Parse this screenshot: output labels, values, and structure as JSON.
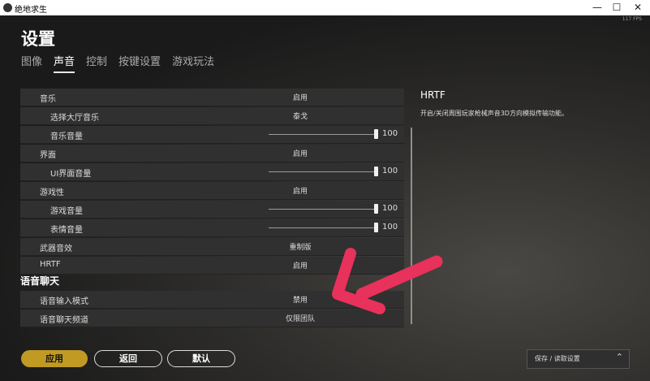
{
  "window": {
    "title": "绝地求生",
    "minimize": "—",
    "maximize": "☐",
    "close": "✕"
  },
  "fps": "117 FPS",
  "page": {
    "title": "设置"
  },
  "tabs": [
    {
      "label": "图像",
      "active": false
    },
    {
      "label": "声音",
      "active": true
    },
    {
      "label": "控制",
      "active": false
    },
    {
      "label": "按键设置",
      "active": false
    },
    {
      "label": "游戏玩法",
      "active": false
    }
  ],
  "settings": [
    {
      "label": "音乐",
      "value": "启用"
    },
    {
      "label": "选择大厅音乐",
      "value": "泰戈"
    },
    {
      "label": "音乐音量",
      "slider_value": "100"
    },
    {
      "label": "界面",
      "value": "启用"
    },
    {
      "label": "UI界面音量",
      "slider_value": "100"
    },
    {
      "label": "游戏性",
      "value": "启用"
    },
    {
      "label": "游戏音量",
      "slider_value": "100"
    },
    {
      "label": "表情音量",
      "slider_value": "100"
    },
    {
      "label": "武器音效",
      "value": "重制版"
    },
    {
      "label": "HRTF",
      "value": "启用"
    }
  ],
  "voice_section": {
    "title": "语音聊天",
    "rows": [
      {
        "label": "语音输入模式",
        "value": "禁用"
      },
      {
        "label": "语音聊天频道",
        "value": "仅限团队"
      }
    ]
  },
  "info_panel": {
    "title": "HRTF",
    "description": "开启/关闭周围玩家枪械声音3D方向模拟传输功能。"
  },
  "buttons": {
    "apply": "应用",
    "back": "返回",
    "default": "默认"
  },
  "save_load": {
    "label": "保存 / 读取设置",
    "chevron": "⌃"
  },
  "colors": {
    "accent": "#c19a23",
    "row_bg": "#303030",
    "annotation_arrow": "#e8315b"
  }
}
